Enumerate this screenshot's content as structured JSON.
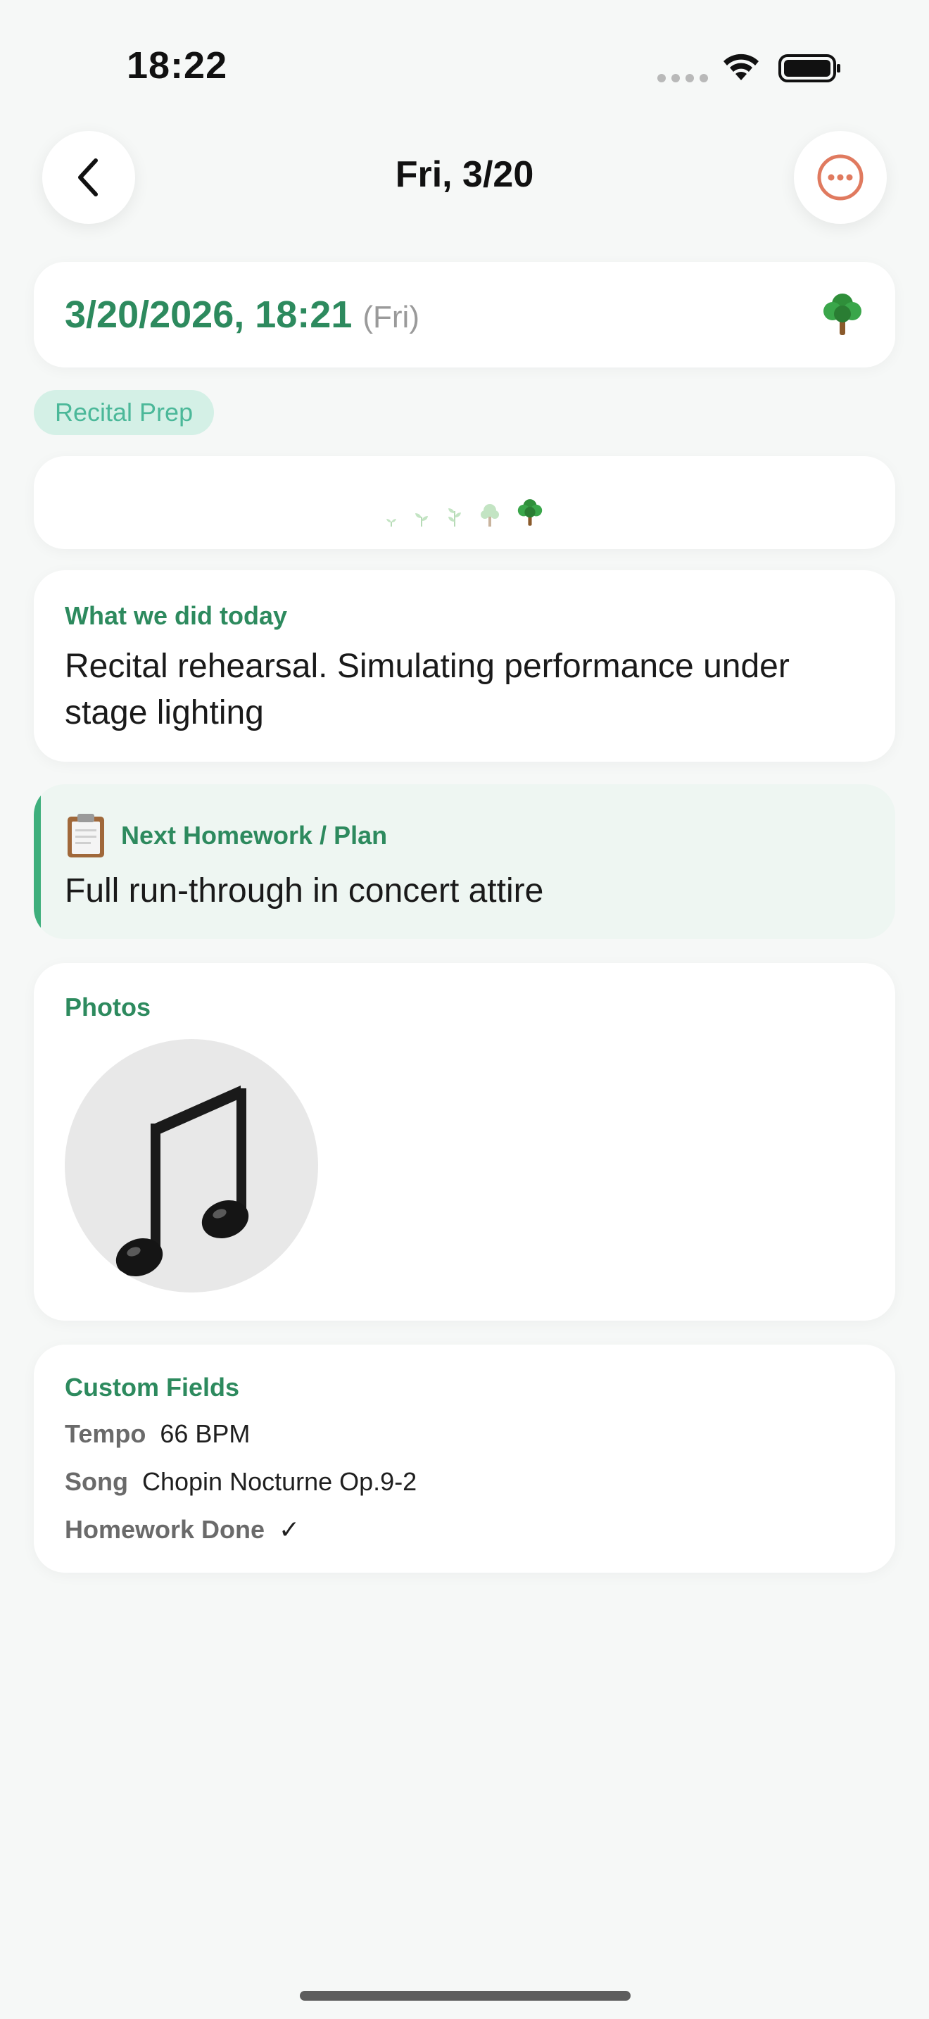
{
  "status_bar": {
    "time": "18:22",
    "icons": [
      "signal-dots-icon",
      "wifi-icon",
      "battery-icon"
    ]
  },
  "nav": {
    "title": "Fri, 3/20",
    "back_icon": "chevron-left-icon",
    "more_icon": "ellipsis-circle-icon"
  },
  "entry": {
    "datetime": "3/20/2026, 18:21",
    "weekday": "(Fri)",
    "mood_icon": "tree-icon"
  },
  "tag": "Recital Prep",
  "growth_stages": [
    "seedling-1-icon",
    "seedling-2-icon",
    "seedling-3-icon",
    "sapling-icon",
    "tree-icon"
  ],
  "selected_stage": 5,
  "today": {
    "label": "What we did today",
    "text": "Recital rehearsal. Simulating performance under stage lighting"
  },
  "plan": {
    "icon": "clipboard-icon",
    "label": "Next Homework / Plan",
    "text": "Full run-through in concert attire"
  },
  "photos": {
    "label": "Photos",
    "items": [
      "music-notes-icon"
    ]
  },
  "custom_fields": {
    "label": "Custom Fields",
    "rows": [
      {
        "name": "Tempo",
        "value": "66 BPM"
      },
      {
        "name": "Song",
        "value": "Chopin Nocturne Op.9-2"
      },
      {
        "name": "Homework Done",
        "value": "✓"
      }
    ]
  },
  "colors": {
    "accent_green": "#2d8a5e",
    "tag_bg": "#d4f0e6",
    "tag_text": "#4bb899",
    "more_button": "#e07a5f",
    "plan_bar": "#3eaf7c"
  }
}
